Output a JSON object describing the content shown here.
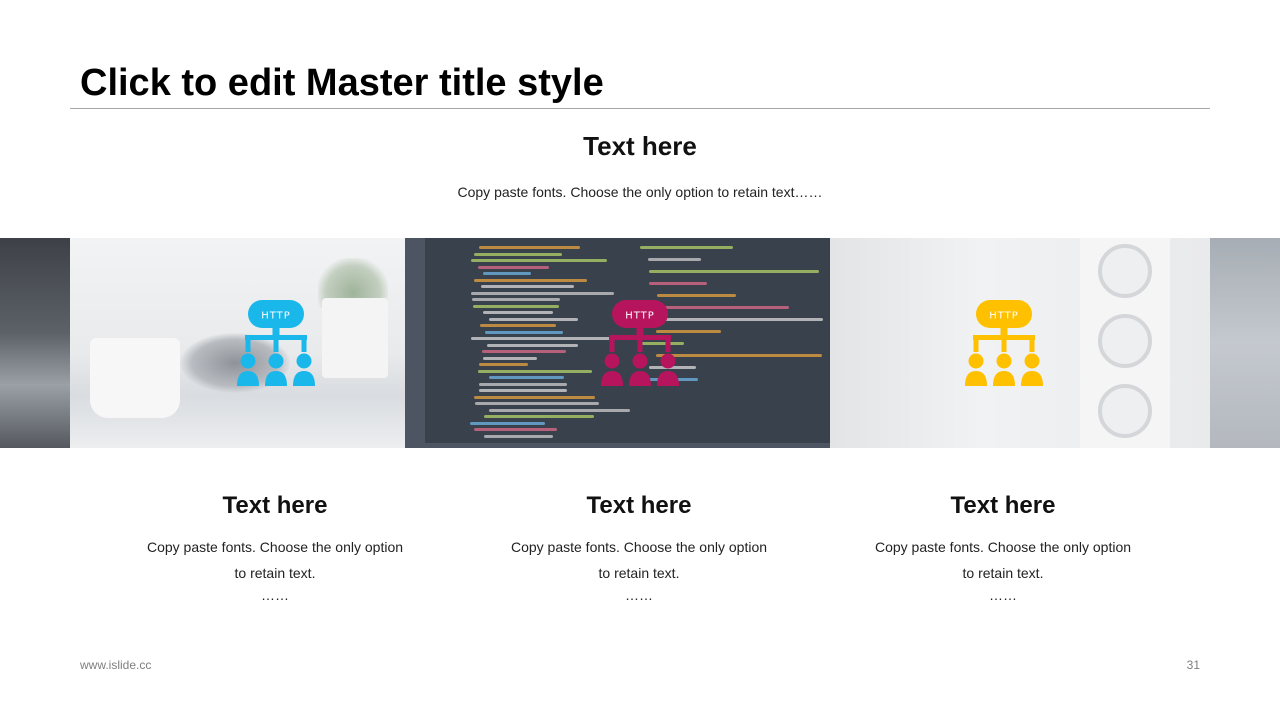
{
  "slide": {
    "title": "Click to edit Master title style",
    "top_heading": "Text here",
    "top_body": "Copy paste fonts. Choose the only option to retain text……"
  },
  "icons": {
    "label": "HTTP",
    "items": [
      {
        "name": "http-network-icon-blue",
        "color": "#1ab7ea"
      },
      {
        "name": "http-network-icon-magenta",
        "color": "#b7145e"
      },
      {
        "name": "http-network-icon-yellow",
        "color": "#ffc000"
      }
    ]
  },
  "columns": [
    {
      "heading": "Text here",
      "line1": "Copy paste fonts. Choose the only option",
      "line2": "to retain text.",
      "dots": "……"
    },
    {
      "heading": "Text here",
      "line1": "Copy paste fonts. Choose the only option",
      "line2": "to retain text.",
      "dots": "……"
    },
    {
      "heading": "Text here",
      "line1": "Copy paste fonts. Choose the only option",
      "line2": "to retain text.",
      "dots": "……"
    }
  ],
  "footer": {
    "url": "www.islide.cc",
    "page_number": "31"
  }
}
